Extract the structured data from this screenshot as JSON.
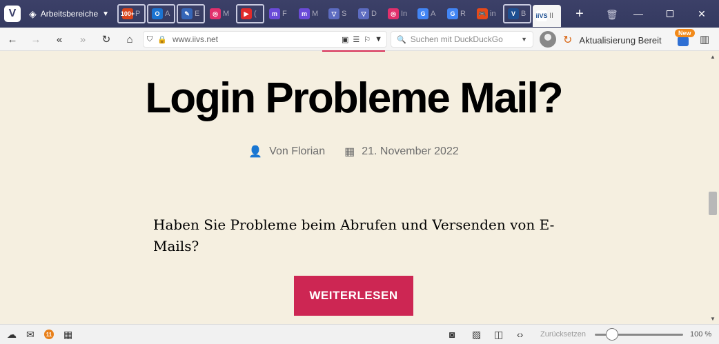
{
  "tabbar": {
    "workspaces_label": "Arbeitsbereiche",
    "tabs": [
      {
        "letter": "P",
        "icon": "100+",
        "color": "#d8441c"
      },
      {
        "letter": "A",
        "icon": "O",
        "color": "#1b73d1"
      },
      {
        "letter": "E",
        "icon": "✎",
        "color": "#3566b8"
      },
      {
        "letter": "M",
        "icon": "◎",
        "color": "#e1306c"
      },
      {
        "letter": "(",
        "icon": "▶",
        "color": "#e02b2b"
      },
      {
        "letter": "F",
        "icon": "m",
        "color": "#6a4bd8"
      },
      {
        "letter": "M",
        "icon": "m",
        "color": "#6a4bd8"
      },
      {
        "letter": "S",
        "icon": "▽",
        "color": "#5c6bc0"
      },
      {
        "letter": "D",
        "icon": "▽",
        "color": "#5c6bc0"
      },
      {
        "letter": "In",
        "icon": "◎",
        "color": "#e1306c"
      },
      {
        "letter": "A",
        "icon": "G",
        "color": "#4285f4"
      },
      {
        "letter": "R",
        "icon": "G",
        "color": "#4285f4"
      },
      {
        "letter": "in",
        "icon": "🎮",
        "color": "#e64a19"
      },
      {
        "letter": "B",
        "icon": "V",
        "color": "#1d4f91"
      },
      {
        "letter": "II",
        "icon": "iiVS",
        "color": "#fff"
      }
    ]
  },
  "navbar": {
    "url": "www.iivs.net",
    "search_placeholder": "Suchen mit DuckDuckGo",
    "update_label": "Aktualisierung Bereit",
    "new_badge": "New"
  },
  "article": {
    "title": "Login Probleme Mail?",
    "author": "Von Florian",
    "date": "21. November 2022",
    "body": "Haben Sie Probleme beim Abrufen und Versenden von E-Mails?",
    "button": "WEITERLESEN"
  },
  "statusbar": {
    "mail_count": "11",
    "reset_label": "Zurücksetzen",
    "zoom": "100 %"
  },
  "colors": {
    "accent": "#cd2653",
    "page_bg": "#f5efe0",
    "tabbar_bg": "#3c4068"
  }
}
